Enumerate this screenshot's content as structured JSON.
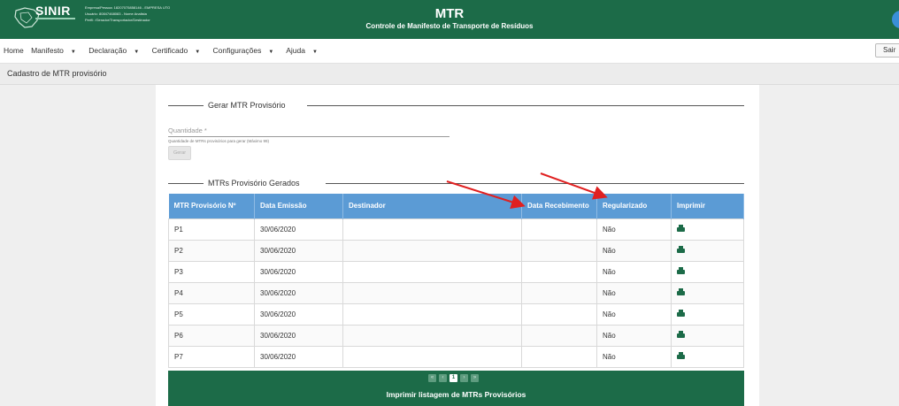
{
  "header": {
    "logo_text": "SINIR",
    "user_lines": [
      "Empresa/Pessoa: 18207075858146 - EMPRESA UTO",
      "Usuário: 80847468083 - Nome Analista",
      "Perfil: /Gerador/Transportador/Destinador"
    ],
    "app_title": "MTR",
    "app_subtitle": "Controle de Manifesto de Transporte de Resíduos"
  },
  "menu": {
    "home": "Home",
    "manifesto": "Manifesto",
    "declaracao": "Declaração",
    "certificado": "Certificado",
    "configuracoes": "Configurações",
    "ajuda": "Ajuda",
    "sair": "Sair"
  },
  "breadcrumb": "Cadastro de MTR provisório",
  "form": {
    "section_title": "Gerar MTR Provisório",
    "quantity_label": "Quantidade *",
    "quantity_help": "Quantidade de MTRs provisórios para gerar (Máximo 99)",
    "generate_button": "Gerar"
  },
  "table": {
    "section_title": "MTRs Provisório Gerados",
    "headers": [
      "MTR Provisório Nº",
      "Data Emissão",
      "Destinador",
      "Data Recebimento",
      "Regularizado",
      "Imprimir"
    ],
    "rows": [
      [
        "P1",
        "30/06/2020",
        "",
        "",
        "Não"
      ],
      [
        "P2",
        "30/06/2020",
        "",
        "",
        "Não"
      ],
      [
        "P3",
        "30/06/2020",
        "",
        "",
        "Não"
      ],
      [
        "P4",
        "30/06/2020",
        "",
        "",
        "Não"
      ],
      [
        "P5",
        "30/06/2020",
        "",
        "",
        "Não"
      ],
      [
        "P6",
        "30/06/2020",
        "",
        "",
        "Não"
      ],
      [
        "P7",
        "30/06/2020",
        "",
        "",
        "Não"
      ]
    ]
  },
  "pagination": {
    "first": "«",
    "prev": "‹",
    "current": "1",
    "next": "›",
    "last": "»"
  },
  "footer": {
    "print_list_label": "Imprimir listagem de MTRs Provisórios"
  },
  "colors": {
    "brand_green": "#1c6b48",
    "table_header_blue": "#5b9bd5",
    "annotation_red": "#e02020"
  },
  "icons": {
    "print": "printer-icon",
    "logo": "brazil-map-logo"
  }
}
